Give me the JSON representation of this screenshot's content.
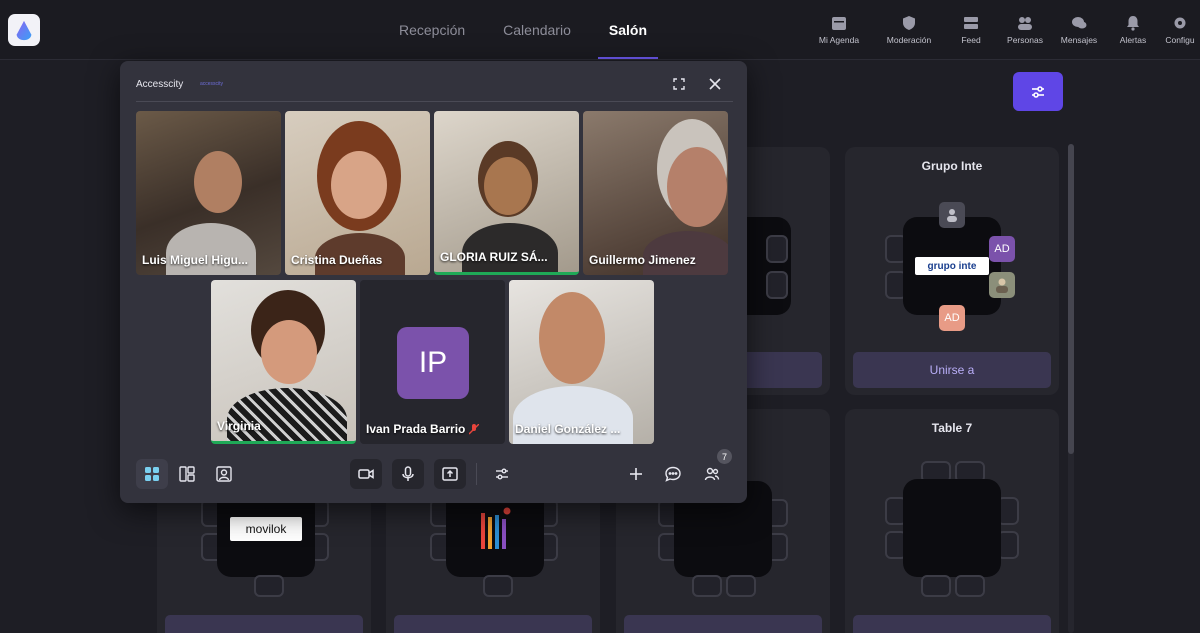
{
  "main_tabs": [
    {
      "label": "Recepción"
    },
    {
      "label": "Calendario"
    },
    {
      "label": "Salón"
    }
  ],
  "nav": [
    {
      "label": "Mi Agenda",
      "icon": "calendar-icon"
    },
    {
      "label": "Moderación",
      "icon": "shield-icon"
    },
    {
      "label": "Feed",
      "icon": "feed-icon"
    },
    {
      "label": "Personas",
      "icon": "people-icon"
    },
    {
      "label": "Mensajes",
      "icon": "chat-icon"
    },
    {
      "label": "Alertas",
      "icon": "bell-icon"
    },
    {
      "label": "Configu",
      "icon": "gear-icon"
    }
  ],
  "tables": [
    {
      "name": "Grupo Inte",
      "logo_text": "grupo inte",
      "avatars": [
        "AD",
        "AD"
      ],
      "join": "Unirse a"
    },
    {
      "name": "Table 7"
    },
    {
      "join": "Unirse a"
    },
    {
      "logo_text": "movilok"
    }
  ],
  "modal": {
    "title": "Accesscity",
    "subtitle": "accesscity",
    "participants": [
      {
        "name": "Luis Miguel Higu..."
      },
      {
        "name": "Cristina Dueñas"
      },
      {
        "name": "GLORIA RUIZ SÁ..."
      },
      {
        "name": "Guillermo Jimenez"
      },
      {
        "name": "Virginia"
      },
      {
        "name": "Ivan Prada Barrio",
        "initials": "IP"
      },
      {
        "name": "Daniel González ..."
      }
    ],
    "people_count": "7"
  },
  "colors": {
    "accent": "#5f46e6",
    "speaking": "#1fa957",
    "avatar_purple": "#7b52ab"
  }
}
